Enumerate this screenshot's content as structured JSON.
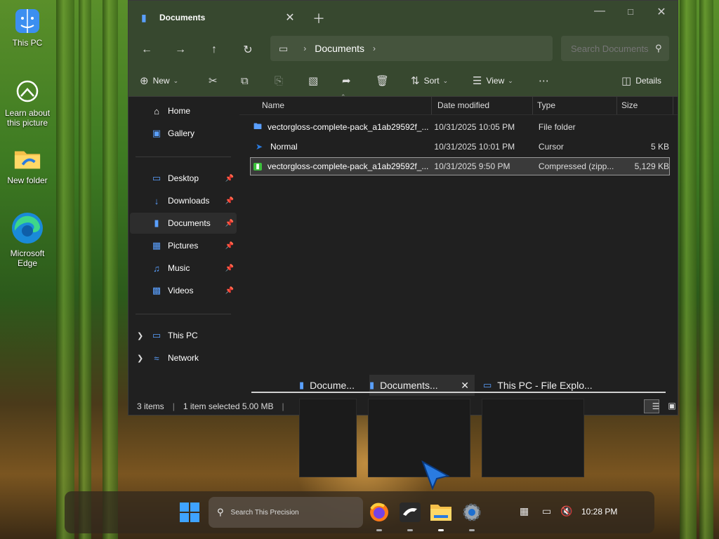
{
  "desktop": {
    "icons": [
      {
        "label": "This PC"
      },
      {
        "label": "Learn about this picture"
      },
      {
        "label": "New folder"
      },
      {
        "label": "Microsoft Edge"
      }
    ]
  },
  "explorer": {
    "tab_title": "Documents",
    "address": {
      "crumb": "Documents"
    },
    "search_placeholder": "Search Documents",
    "commands": {
      "new": "New",
      "sort": "Sort",
      "view": "View",
      "details": "Details"
    },
    "sidebar": {
      "items": [
        {
          "label": "Home",
          "icon": "home-icon"
        },
        {
          "label": "Gallery",
          "icon": "gallery-icon"
        },
        {
          "label": "Desktop",
          "icon": "desktop-icon"
        },
        {
          "label": "Downloads",
          "icon": "downloads-icon"
        },
        {
          "label": "Documents",
          "icon": "documents-icon"
        },
        {
          "label": "Pictures",
          "icon": "pictures-icon"
        },
        {
          "label": "Music",
          "icon": "music-icon"
        },
        {
          "label": "Videos",
          "icon": "videos-icon"
        },
        {
          "label": "This PC",
          "icon": "pc-icon"
        },
        {
          "label": "Network",
          "icon": "network-icon"
        }
      ]
    },
    "columns": {
      "name": "Name",
      "date": "Date modified",
      "type": "Type",
      "size": "Size"
    },
    "files": [
      {
        "name": "vectorgloss-complete-pack_a1ab29592f_...",
        "date": "10/31/2025 10:05 PM",
        "type": "File folder",
        "size": ""
      },
      {
        "name": "Normal",
        "date": "10/31/2025 10:01 PM",
        "type": "Cursor",
        "size": "5 KB"
      },
      {
        "name": "vectorgloss-complete-pack_a1ab29592f_...",
        "date": "10/31/2025 9:50 PM",
        "type": "Compressed (zipp...",
        "size": "5,129 KB"
      }
    ],
    "status": {
      "items": "3 items",
      "selected": "1 item selected  5.00 MB"
    }
  },
  "taskbar_previews": {
    "tabs": [
      {
        "label": "Docume..."
      },
      {
        "label": "Documents..."
      },
      {
        "label": "This PC - File Explo..."
      }
    ]
  },
  "taskbar": {
    "search_placeholder": "Search This Precision",
    "clock": "10:28 PM"
  }
}
